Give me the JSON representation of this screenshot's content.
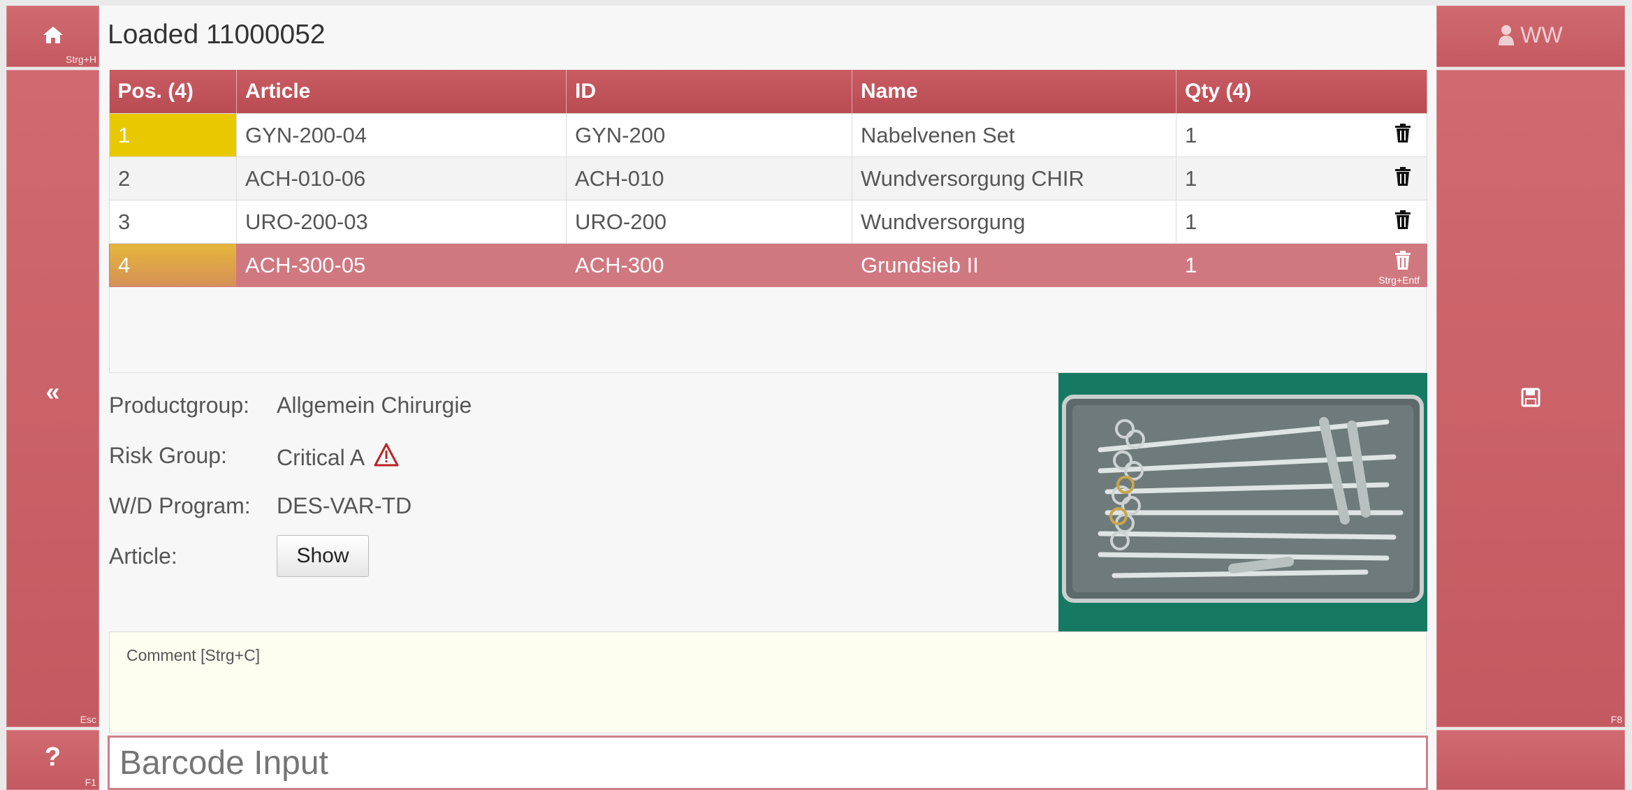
{
  "left_nav": {
    "home_icon": "home-icon",
    "home_hint": "Strg+H",
    "back_icon": "«",
    "back_hint": "Esc",
    "help_icon": "?",
    "help_hint": "F1"
  },
  "right_nav": {
    "user_initials": "WW",
    "save_hint": "F8"
  },
  "page": {
    "title": "Loaded 11000052"
  },
  "table": {
    "headers": [
      "Pos. (4)",
      "Article",
      "ID",
      "Name",
      "Qty (4)"
    ],
    "rows": [
      {
        "pos": "1",
        "article": "GYN-200-04",
        "id": "GYN-200",
        "name": "Nabelvenen Set",
        "qty": "1"
      },
      {
        "pos": "2",
        "article": "ACH-010-06",
        "id": "ACH-010",
        "name": "Wundversorgung CHIR",
        "qty": "1"
      },
      {
        "pos": "3",
        "article": "URO-200-03",
        "id": "URO-200",
        "name": "Wundversorgung",
        "qty": "1"
      },
      {
        "pos": "4",
        "article": "ACH-300-05",
        "id": "ACH-300",
        "name": "Grundsieb II",
        "qty": "1"
      }
    ],
    "delete_hint": "Strg+Entf"
  },
  "details": {
    "productgroup_label": "Productgroup:",
    "productgroup_value": "Allgemein Chirurgie",
    "risk_label": "Risk Group:",
    "risk_value": "Critical A",
    "wd_label": "W/D Program:",
    "wd_value": "DES-VAR-TD",
    "article_label": "Article:",
    "show_button": "Show"
  },
  "comment": {
    "placeholder": "Comment [Strg+C]"
  },
  "barcode": {
    "placeholder": "Barcode Input"
  },
  "colors": {
    "accent": "#c45a61",
    "selected_row": "#d07880",
    "pos_highlight": "#e8c800",
    "comment_bg": "#fdfdf0"
  }
}
